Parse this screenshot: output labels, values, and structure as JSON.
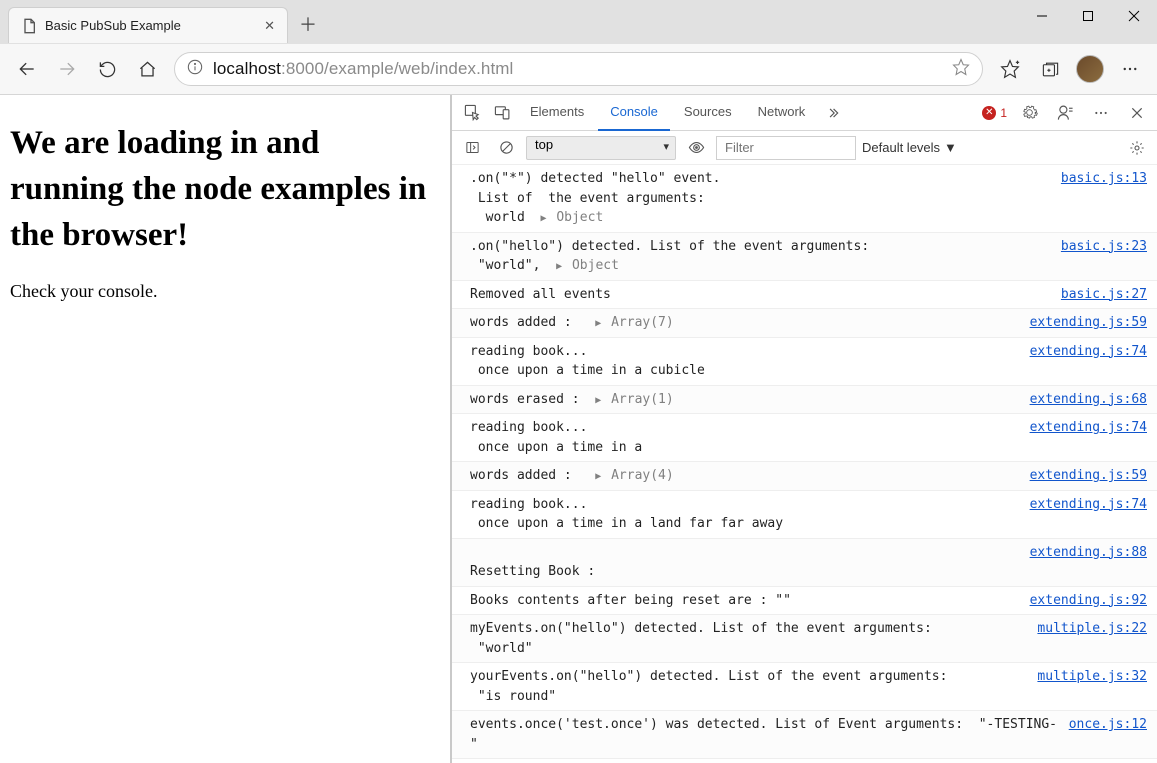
{
  "browser": {
    "tab_title": "Basic PubSub Example",
    "url_host": "localhost",
    "url_port_path": ":8000/example/web/index.html"
  },
  "page": {
    "heading": "We are loading in and running the node examples in the browser!",
    "subtext": "Check your console."
  },
  "devtools": {
    "tabs": {
      "elements": "Elements",
      "console": "Console",
      "sources": "Sources",
      "network": "Network"
    },
    "error_count": "1",
    "context": "top",
    "filter_placeholder": "Filter",
    "levels_label": "Default levels",
    "log": [
      {
        "src": "basic.js:13",
        "lines": [
          ".on(\"*\") detected \"hello\" event.",
          " List of  the event arguments:",
          "  world  ▸ Object"
        ]
      },
      {
        "src": "basic.js:23",
        "lines": [
          ".on(\"hello\") detected. List of the event arguments:",
          " \"world\",  ▸ Object"
        ]
      },
      {
        "src": "basic.js:27",
        "lines": [
          "Removed all events"
        ]
      },
      {
        "src": "extending.js:59",
        "lines": [
          "words added :   ▸ Array(7)"
        ]
      },
      {
        "src": "extending.js:74",
        "lines": [
          "reading book...",
          " once upon a time in a cubicle"
        ]
      },
      {
        "src": "extending.js:68",
        "lines": [
          "words erased :  ▸ Array(1)"
        ]
      },
      {
        "src": "extending.js:74",
        "lines": [
          "reading book...",
          " once upon a time in a"
        ]
      },
      {
        "src": "extending.js:59",
        "lines": [
          "words added :   ▸ Array(4)"
        ]
      },
      {
        "src": "extending.js:74",
        "lines": [
          "reading book...",
          " once upon a time in a land far far away"
        ]
      },
      {
        "src": "extending.js:88",
        "lines": [
          "",
          "Resetting Book :"
        ]
      },
      {
        "src": "extending.js:92",
        "lines": [
          "Books contents after being reset are : \"\"",
          ""
        ]
      },
      {
        "src": "multiple.js:22",
        "lines": [
          "myEvents.on(\"hello\") detected. List of the event arguments:",
          " \"world\""
        ]
      },
      {
        "src": "multiple.js:32",
        "lines": [
          "yourEvents.on(\"hello\") detected. List of the event arguments:",
          " \"is round\""
        ]
      },
      {
        "src": "once.js:12",
        "lines": [
          "events.once('test.once') was detected. List of Event arguments:  \"-TESTING-\""
        ]
      }
    ]
  }
}
